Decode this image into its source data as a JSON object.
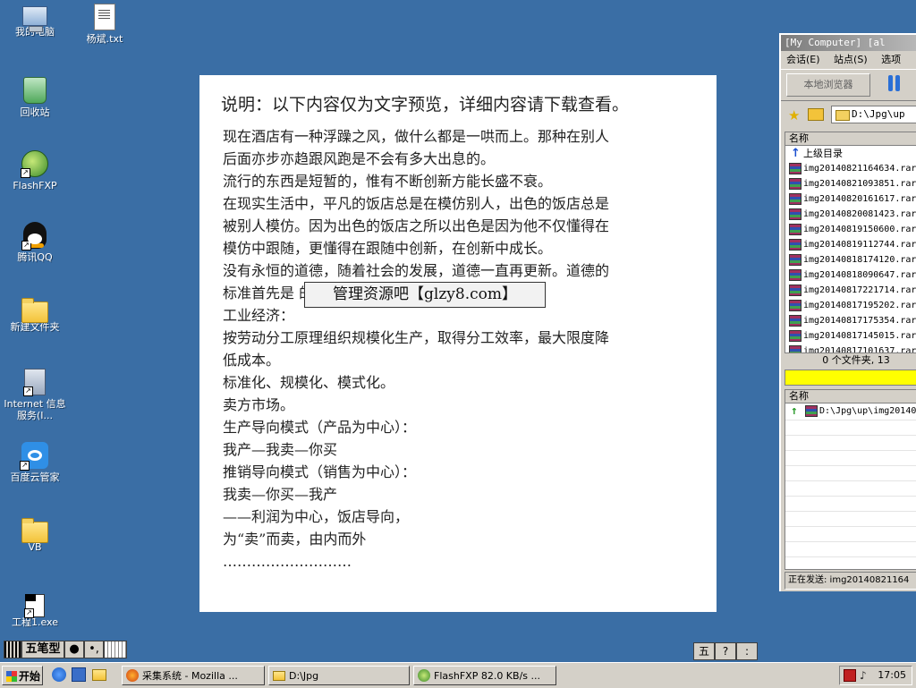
{
  "desktop": {
    "icons": [
      {
        "label": "我的电脑",
        "icon": "computer-icon"
      },
      {
        "label": "杨斌.txt",
        "icon": "text-file-icon"
      },
      {
        "label": "回收站",
        "icon": "recycle-bin-icon"
      },
      {
        "label": "FlashFXP",
        "icon": "flashfxp-icon"
      },
      {
        "label": "腾讯QQ",
        "icon": "qq-icon"
      },
      {
        "label": "新建文件夹",
        "icon": "folder-icon"
      },
      {
        "label": "Internet 信息服务(I...",
        "icon": "iis-icon"
      },
      {
        "label": "百度云管家",
        "icon": "baidu-cloud-icon"
      },
      {
        "label": "VB",
        "icon": "folder-icon"
      },
      {
        "label": "工程1.exe",
        "icon": "exe-icon"
      }
    ]
  },
  "document": {
    "title": "说明：以下内容仅为文字预览，详细内容请下载查看。",
    "lines": [
      "现在酒店有一种浮躁之风，做什么都是一哄而上。那种在别人",
      "后面亦步亦趋跟风跑是不会有多大出息的。",
      "流行的东西是短暂的，惟有不断创新方能长盛不衰。",
      "在现实生活中，平凡的饭店总是在模仿别人，出色的饭店总是",
      "被别人模仿。因为出色的饭店之所以出色是因为他不仅懂得在",
      "模仿中跟随，更懂得在跟随中创新，在创新中成长。",
      "没有永恒的道德，随着社会的发展，道德一直再更新。道德的",
      "标准首先是                              的利益。",
      "工业经济：",
      "按劳动分工原理组织规模化生产，取得分工效率，最大限度降",
      "低成本。",
      "标准化、规模化、模式化。",
      "卖方市场。",
      "生产导向模式（产品为中心）：",
      "我产—我卖—你买",
      "推销导向模式（销售为中心）：",
      "我卖—你买—我产",
      "——利润为中心，饭店导向，",
      "为“卖”而卖，由内而外",
      "………………………"
    ],
    "watermark": "管理资源吧【glzy8.com】"
  },
  "flashfxp": {
    "title": "[My Computer]  [al",
    "menu": [
      "会话(E)",
      "站点(S)",
      "选项"
    ],
    "local_browser_btn": "本地浏览器",
    "path": "D:\\Jpg\\up",
    "list_header": "名称",
    "parent_dir": "上级目录",
    "files": [
      "img20140821164634.rar",
      "img20140821093851.rar",
      "img20140820161617.rar",
      "img20140820081423.rar",
      "img20140819150600.rar",
      "img20140819112744.rar",
      "img20140818174120.rar",
      "img20140818090647.rar",
      "img20140817221714.rar",
      "img20140817195202.rar",
      "img20140817175354.rar",
      "img20140817145015.rar",
      "img20140817101637.rar"
    ],
    "status": "0 个文件夹, 13",
    "queue_header": "名称",
    "queue_item": "D:\\Jpg\\up\\img20140",
    "statusbar": "正在发送: img20140821164"
  },
  "ime": {
    "mode": "五笔型",
    "symbol1": "●",
    "symbol2": "•,",
    "right1": "五",
    "right2": "?",
    "right3": ":"
  },
  "taskbar": {
    "start": "开始",
    "tasks": [
      {
        "label": "采集系统 - Mozilla ..."
      },
      {
        "label": "D:\\Jpg"
      },
      {
        "label": "FlashFXP 82.0 KB/s ..."
      }
    ],
    "clock": "17:05"
  }
}
